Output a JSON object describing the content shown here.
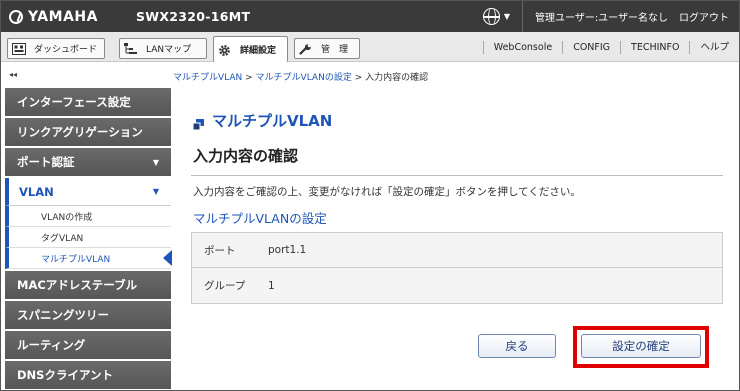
{
  "header": {
    "brand": "YAMAHA",
    "model": "SWX2320-16MT",
    "user": "管理ユーザー:ユーザー名なし",
    "logout": "ログアウト"
  },
  "toolbar": {
    "buttons": [
      {
        "label": "ダッシュボード",
        "icon": "dashboard-icon"
      },
      {
        "label": "LANマップ",
        "icon": "lanmap-icon"
      },
      {
        "label": "詳細設定",
        "icon": "gear-icon",
        "active": true
      },
      {
        "label": "管　理",
        "icon": "wrench-icon"
      }
    ],
    "links": [
      "WebConsole",
      "CONFIG",
      "TECHINFO",
      "ヘルプ"
    ]
  },
  "breadcrumb": {
    "collapse": "◂◂",
    "items": [
      "マルチプルVLAN",
      "マルチプルVLANの設定",
      "入力内容の確認"
    ],
    "sep": " > "
  },
  "sidebar": {
    "items": [
      {
        "label": "インターフェース設定"
      },
      {
        "label": "リンクアグリゲーション"
      },
      {
        "label": "ポート認証",
        "arrow": "▼"
      },
      {
        "label": "VLAN",
        "arrow": "▼",
        "open": true
      },
      {
        "label": "MACアドレステーブル"
      },
      {
        "label": "スパニングツリー"
      },
      {
        "label": "ルーティング"
      },
      {
        "label": "DNSクライアント"
      }
    ],
    "vlan_sub": [
      "VLANの作成",
      "タグVLAN",
      "マルチプルVLAN"
    ]
  },
  "main": {
    "title": "マルチプルVLAN",
    "heading": "入力内容の確認",
    "description": "入力内容をご確認の上、変更がなければ「設定の確定」ボタンを押してください。",
    "section": "マルチプルVLANの設定",
    "rows": [
      {
        "key": "ポート",
        "value": "port1.1"
      },
      {
        "key": "グループ",
        "value": "1"
      }
    ],
    "back_label": "戻る",
    "confirm_label": "設定の確定"
  },
  "colors": {
    "accent": "#1f55b8",
    "header_bg": "#3a3a3a",
    "highlight": "#e00000"
  }
}
